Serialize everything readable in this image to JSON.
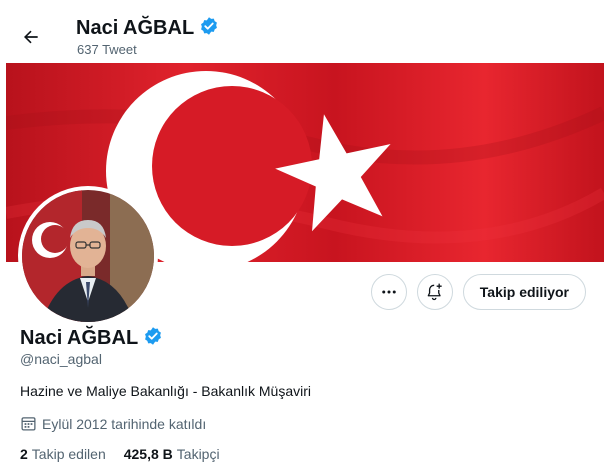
{
  "header": {
    "name": "Naci AĞBAL",
    "tweet_count": "637 Tweet"
  },
  "profile": {
    "name": "Naci AĞBAL",
    "handle": "@naci_agbal",
    "bio": "Hazine ve Maliye Bakanlığı - Bakanlık Müşaviri",
    "joined": "Eylül 2012 tarihinde katıldı",
    "following_count": "2",
    "following_label": "Takip edilen",
    "followers_count": "425,8 B",
    "followers_label": "Takipçi"
  },
  "actions": {
    "follow_label": "Takip ediliyor"
  },
  "icons": [
    "back-arrow-icon",
    "verified-badge-icon",
    "more-icon",
    "bell-plus-icon",
    "calendar-icon"
  ],
  "colors": {
    "verified": "#1d9bf0",
    "flag_red": "#d61b26",
    "text_secondary": "#536471"
  }
}
